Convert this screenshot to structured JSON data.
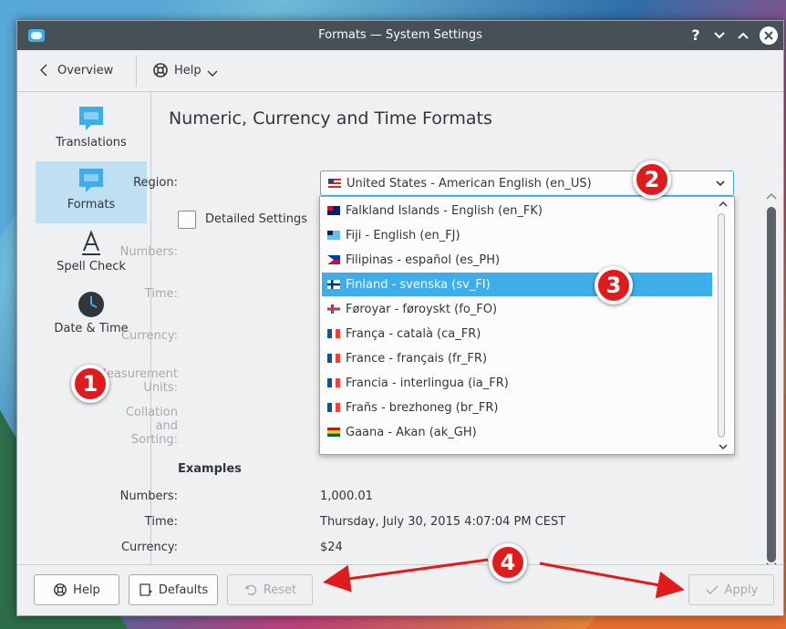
{
  "window": {
    "title": "Formats — System Settings"
  },
  "titlebar": {
    "help_glyph": "?",
    "minimize_glyph": "⌄",
    "maximize_glyph": "⌃",
    "close_glyph": "✕"
  },
  "toolbar": {
    "overview_label": "Overview",
    "help_label": "Help"
  },
  "sidebar": {
    "items": [
      {
        "label": "Translations",
        "icon": "translations-icon"
      },
      {
        "label": "Formats",
        "icon": "formats-icon"
      },
      {
        "label": "Spell Check",
        "icon": "spell-check-icon"
      },
      {
        "label": "Date & Time",
        "icon": "date-time-icon"
      }
    ],
    "active_index": 1
  },
  "main": {
    "title": "Numeric, Currency and Time Formats",
    "region_label": "Region:",
    "region_value": "United States - American English (en_US)",
    "detailed_settings_label": "Detailed Settings",
    "detailed_settings_checked": false,
    "settings_labels": [
      "Numbers:",
      "Time:",
      "Currency:",
      "Measurement Units:",
      "Collation and Sorting:"
    ]
  },
  "dropdown": {
    "items": [
      {
        "label": "Falkland Islands - English (en_FK)",
        "flag": "falkland-islands-flag"
      },
      {
        "label": "Fiji - English (en_FJ)",
        "flag": "fiji-flag"
      },
      {
        "label": "Filipinas - español (es_PH)",
        "flag": "philippines-flag"
      },
      {
        "label": "Finland - svenska (sv_FI)",
        "flag": "finland-flag"
      },
      {
        "label": "Føroyar - føroyskt (fo_FO)",
        "flag": "faroe-islands-flag"
      },
      {
        "label": "França - català (ca_FR)",
        "flag": "france-flag"
      },
      {
        "label": "France - français (fr_FR)",
        "flag": "france-flag"
      },
      {
        "label": "Francia - interlingua (ia_FR)",
        "flag": "france-flag"
      },
      {
        "label": "Frañs - brezhoneg (br_FR)",
        "flag": "france-flag"
      },
      {
        "label": "Gaana - Akan (ak_GH)",
        "flag": "ghana-flag"
      }
    ],
    "selected_index": 3
  },
  "examples": {
    "heading": "Examples",
    "numbers_label": "Numbers:",
    "numbers_value": "1,000.01",
    "time_label": "Time:",
    "time_value": "Thursday, July 30, 2015 4:07:04 PM CEST",
    "currency_label": "Currency:",
    "currency_value": "$24"
  },
  "footer": {
    "help_label": "Help",
    "defaults_label": "Defaults",
    "reset_label": "Reset",
    "apply_label": "Apply"
  },
  "annotations": {
    "badge1": "1",
    "badge2": "2",
    "badge3": "3",
    "badge4": "4"
  },
  "colors": {
    "accent": "#3daee9",
    "selection": "#bfdff3",
    "titlebar": "#475057",
    "annotation": "#e01b1b"
  }
}
